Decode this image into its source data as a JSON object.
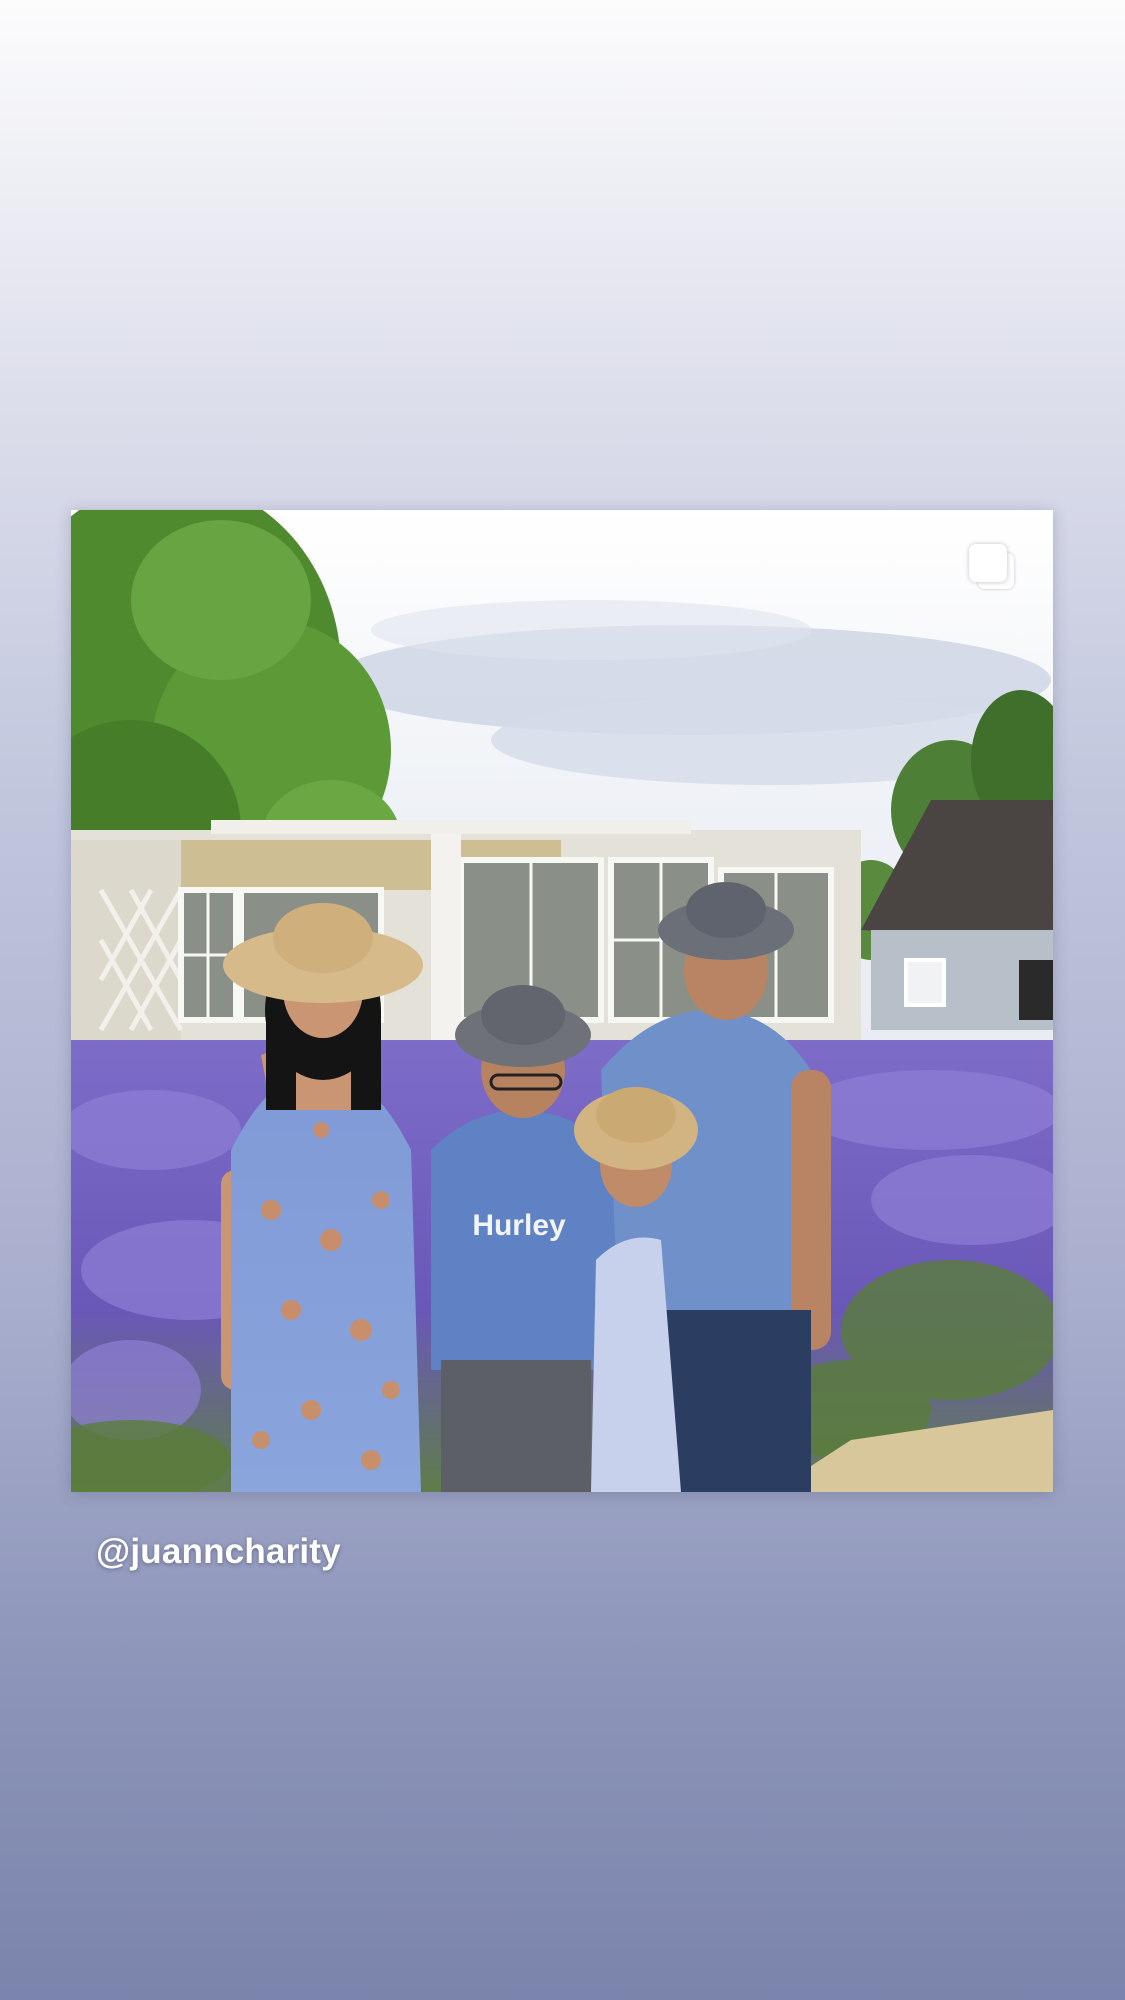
{
  "story": {
    "background_colors": [
      "#fcfcfd",
      "#c1c6dd",
      "#7b84ac"
    ]
  },
  "post": {
    "has_multiple_images": true,
    "multi_indicator_icon": "multiple-photos-icon",
    "shirt_print": "Hurley"
  },
  "mention": {
    "handle": "@juanncharity"
  },
  "colors": {
    "lavender": "#7e63c4",
    "sky": "#f4f6fa",
    "shirt_blue": "#6f90c9"
  }
}
